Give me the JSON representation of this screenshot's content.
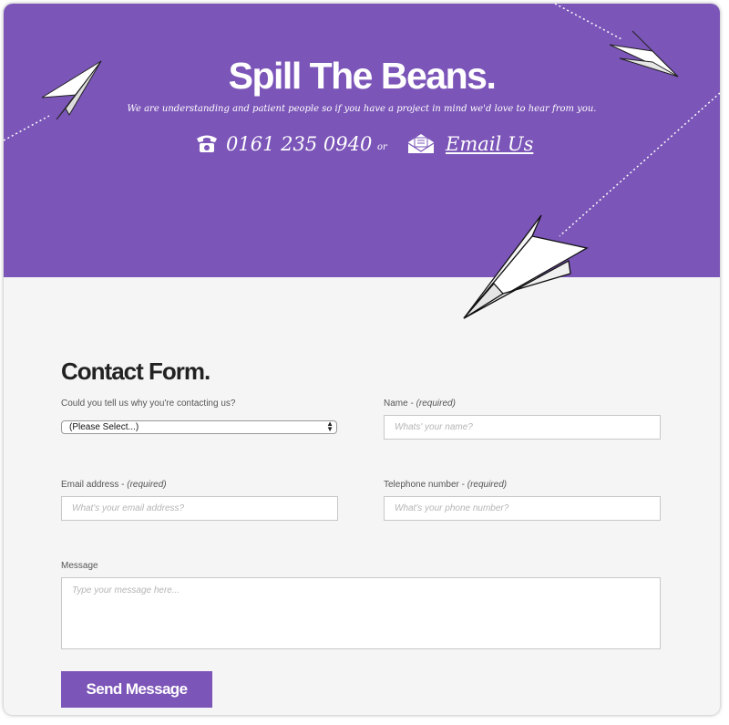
{
  "header": {
    "title": "Spill The Beans.",
    "subtitle": "We are understanding and patient people so if you have a project in mind we'd love to hear from you.",
    "phone": "0161 235 0940",
    "or_text": "or",
    "email_link": "Email Us",
    "accent_color": "#7b55b8"
  },
  "form": {
    "title": "Contact Form.",
    "reason": {
      "label": "Could you tell us why you're contacting us?",
      "selected": "(Please Select...)"
    },
    "name": {
      "label": "Name - ",
      "required": "(required)",
      "placeholder": "Whats' your name?"
    },
    "email": {
      "label": "Email address - ",
      "required": "(required)",
      "placeholder": "What's your email address?"
    },
    "phone": {
      "label": "Telephone number - ",
      "required": "(required)",
      "placeholder": "What's your phone number?"
    },
    "message": {
      "label": "Message",
      "placeholder": "Type your message here..."
    },
    "submit_label": "Send Message"
  },
  "icons": [
    "phone-icon",
    "envelope-icon",
    "paper-plane-icon"
  ]
}
